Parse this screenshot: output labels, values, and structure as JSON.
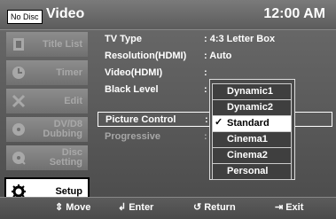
{
  "header": {
    "disc_badge": "No Disc",
    "title": "Video",
    "time": "12:00 AM"
  },
  "sidebar": {
    "items": [
      {
        "label": "Title List",
        "icon": "title-list-icon"
      },
      {
        "label": "Timer",
        "icon": "timer-icon"
      },
      {
        "label": "Edit",
        "icon": "edit-icon"
      },
      {
        "label": "DV/D8 Dubbing",
        "line1": "DV/D8",
        "line2": "Dubbing",
        "icon": "dubbing-icon"
      },
      {
        "label": "Disc Setting",
        "line1": "Disc",
        "line2": "Setting",
        "icon": "disc-setting-icon"
      },
      {
        "label": "Setup",
        "icon": "gear-icon",
        "active": true
      }
    ]
  },
  "settings": [
    {
      "key": "TV Type",
      "value": ": 4:3 Letter Box"
    },
    {
      "key": "Resolution(HDMI)",
      "value": ": Auto"
    },
    {
      "key": "Video(HDMI)",
      "value": ":"
    },
    {
      "key": "Black Level",
      "value": ":"
    },
    {
      "key": "Picture Control",
      "value": ":"
    },
    {
      "key": "Progressive",
      "value": ":"
    }
  ],
  "dropdown": {
    "options": [
      "Dynamic1",
      "Dynamic2",
      "Standard",
      "Cinema1",
      "Cinema2",
      "Personal"
    ],
    "selected": "Standard"
  },
  "footer": {
    "move": "Move",
    "enter": "Enter",
    "return": "Return",
    "exit": "Exit"
  }
}
